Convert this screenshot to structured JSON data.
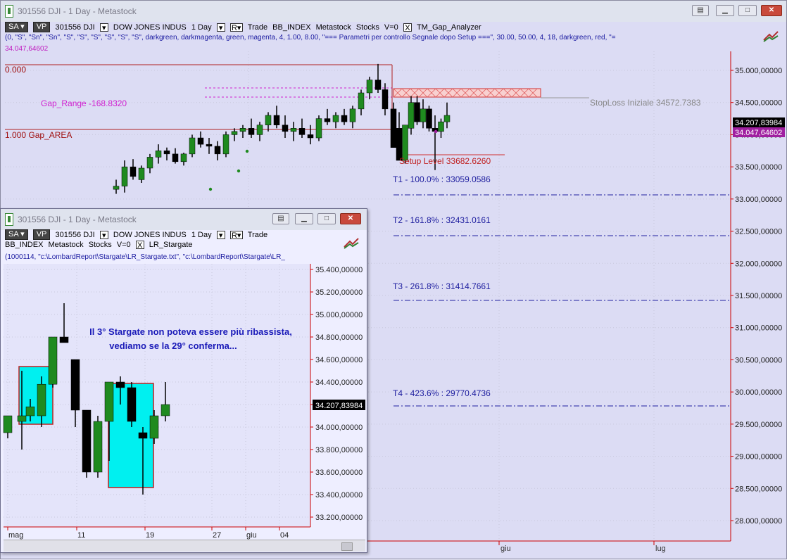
{
  "main": {
    "title": "301556 DJI - 1 Day - Metastock",
    "toolbar": {
      "sa": "SA",
      "vp": "VP",
      "symbol": "301556 DJI",
      "name": "DOW JONES INDUS",
      "period": "1 Day",
      "rlabel": "R",
      "trade": "Trade",
      "source": "BB_INDEX",
      "src2": "Metastock",
      "src3": "Stocks",
      "v": "V=0",
      "x": "X",
      "indicator": "TM_Gap_Analyzer"
    },
    "params": "(0,  \"S\",  \"Sn\",  \"Sn\",  \"S\",  \"S\",  \"S\",  \"S\",  \"S\",  \"S\",  darkgreen,  darkmagenta,  green,  magenta,  4,  1.00,  8.00,  \"=== Parametri per controllo Segnale dopo Setup ===\",  30.00,  50.00,  4,  18,  darkgreen,  red,  \"=",
    "value_line": "34.047,64602",
    "labels": {
      "zero": "0.000",
      "gap_range": "Gap_Range -168.8320",
      "gap_area": "1.000 Gap_AREA",
      "stoploss": "StopLoss Iniziale 34572.7383",
      "setup": "Setup Level 33682.6260",
      "t1": "T1 - 100.0% : 33059.0586",
      "t2": "T2 - 161.8% : 32431.0161",
      "t3": "T3 - 261.8% : 31414.7661",
      "t4": "T4 - 423.6% : 29770.4736"
    },
    "yaxis": [
      "35.000,00000",
      "34.500,00000",
      "34.000,00000",
      "33.500,00000",
      "33.000,00000",
      "32.500,00000",
      "32.000,00000",
      "31.500,00000",
      "31.000,00000",
      "30.500,00000",
      "30.000,00000",
      "29.500,00000",
      "29.000,00000",
      "28.500,00000",
      "28.000,00000"
    ],
    "price_tag": "34.207,83984",
    "price_tag2": "34.047,64602",
    "xaxis": [
      "giu",
      "lug"
    ]
  },
  "sub": {
    "title": "301556 DJI - 1 Day - Metastock",
    "toolbar": {
      "sa": "SA",
      "vp": "VP",
      "symbol": "301556 DJI",
      "name": "DOW JONES INDUS",
      "period": "1 Day",
      "rlabel": "R",
      "trade": "Trade",
      "source": "BB_INDEX",
      "src2": "Metastock",
      "src3": "Stocks",
      "v": "V=0",
      "x": "X",
      "indicator": "LR_Stargate"
    },
    "params": "(1000114,  \"c:\\LombardReport\\Stargate\\LR_Stargate.txt\",  \"c:\\LombardReport\\Stargate\\LR_",
    "annotation_line1": "Il 3° Stargate non poteva essere più ribassista,",
    "annotation_line2": "vediamo se la 29° conferma...",
    "yaxis": [
      "35.400,00000",
      "35.200,00000",
      "35.000,00000",
      "34.800,00000",
      "34.600,00000",
      "34.400,00000",
      "34.200,00000",
      "34.000,00000",
      "33.800,00000",
      "33.600,00000",
      "33.400,00000",
      "33.200,00000"
    ],
    "price_tag": "34.207,83984",
    "xaxis": [
      "mag",
      "11",
      "19",
      "27",
      "giu",
      "04"
    ]
  },
  "colors": {
    "up": "#1f8a1f",
    "down": "#000000",
    "bg": "#e4e4fa",
    "magenta": "#d020d0",
    "target": "#2020a0",
    "redline": "#b02020",
    "stargate": "#00f0f0"
  }
}
